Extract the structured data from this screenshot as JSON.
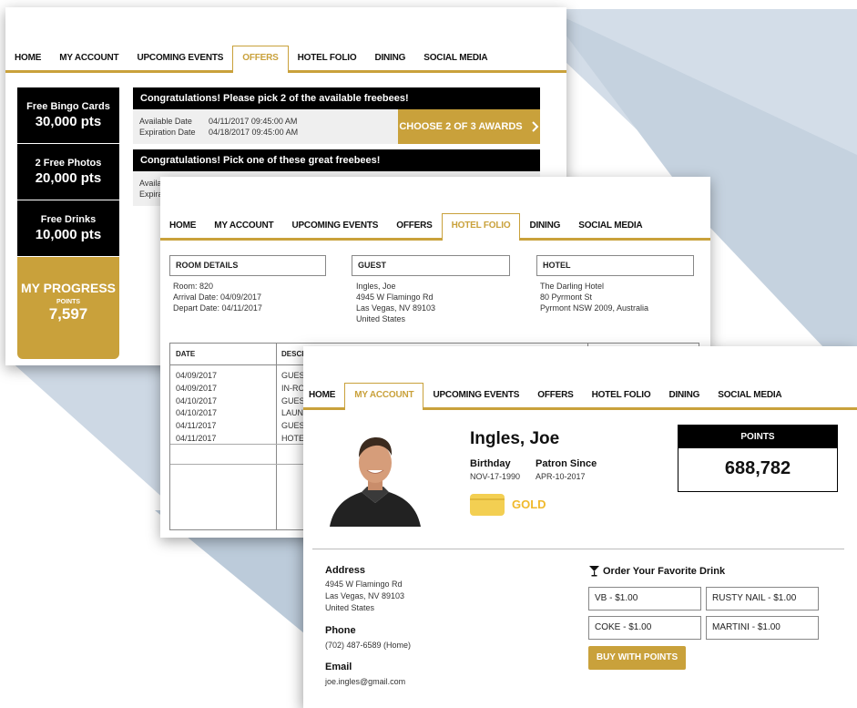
{
  "window1": {
    "nav": [
      "HOME",
      "MY ACCOUNT",
      "UPCOMING EVENTS",
      "OFFERS",
      "HOTEL FOLIO",
      "DINING",
      "SOCIAL MEDIA"
    ],
    "active_tab": "OFFERS",
    "sidebar": [
      {
        "title": "Free Bingo Cards",
        "points": "30,000 pts"
      },
      {
        "title": "2 Free Photos",
        "points": "20,000 pts"
      },
      {
        "title": "Free Drinks",
        "points": "10,000 pts"
      }
    ],
    "progress": {
      "title": "MY PROGRESS",
      "sub": "POINTS",
      "value": "7,597"
    },
    "offers": [
      {
        "header": "Congratulations! Please pick 2 of the available freebees!",
        "available_label": "Available Date",
        "available_value": "04/11/2017 09:45:00 AM",
        "expiration_label": "Expiration Date",
        "expiration_value": "04/18/2017 09:45:00 AM",
        "button": "CHOOSE 2 OF 3 AWARDS"
      },
      {
        "header": "Congratulations! Pick one of these great freebees!",
        "available_label": "Availa",
        "expiration_label": "Expira"
      }
    ]
  },
  "window2": {
    "nav": [
      "HOME",
      "MY ACCOUNT",
      "UPCOMING EVENTS",
      "OFFERS",
      "HOTEL FOLIO",
      "DINING",
      "SOCIAL MEDIA"
    ],
    "active_tab": "HOTEL FOLIO",
    "room": {
      "header": "ROOM DETAILS",
      "lines": [
        "Room: 820",
        "Arrival Date: 04/09/2017",
        "Depart Date: 04/11/2017"
      ]
    },
    "guest": {
      "header": "GUEST",
      "lines": [
        "Ingles, Joe",
        "4945 W Flamingo Rd",
        "Las Vegas, NV 89103",
        "United States"
      ]
    },
    "hotel": {
      "header": "HOTEL",
      "lines": [
        "The Darling Hotel",
        "80 Pyrmont St",
        "Pyrmont NSW 2009, Australia"
      ]
    },
    "table": {
      "headers": [
        "DATE",
        "DESCRI"
      ],
      "dates": [
        "04/09/2017",
        "04/09/2017",
        "04/10/2017",
        "04/10/2017",
        "04/11/2017",
        "04/11/2017"
      ],
      "descriptions": [
        "GUES",
        "IN-RO",
        "GUES",
        "LAUN",
        "GUES",
        "HOTE"
      ]
    }
  },
  "window3": {
    "nav": [
      "HOME",
      "MY ACCOUNT",
      "UPCOMING EVENTS",
      "OFFERS",
      "HOTEL FOLIO",
      "DINING",
      "SOCIAL MEDIA"
    ],
    "active_tab": "MY ACCOUNT",
    "name": "Ingles, Joe",
    "birthday_label": "Birthday",
    "birthday": "NOV-17-1990",
    "patron_label": "Patron Since",
    "patron_since": "APR-10-2017",
    "tier": "GOLD",
    "points_label": "POINTS",
    "points": "688,782",
    "address_label": "Address",
    "address": [
      "4945 W Flamingo Rd",
      "Las Vegas, NV 89103",
      "United States"
    ],
    "phone_label": "Phone",
    "phone": "(702) 487-6589 (Home)",
    "email_label": "Email",
    "email": "joe.ingles@gmail.com",
    "drink_header": "Order Your Favorite Drink",
    "drinks": [
      "VB - $1.00",
      "RUSTY NAIL - $1.00",
      "COKE - $1.00",
      "MARTINI - $1.00"
    ],
    "buy_button": "BUY WITH POINTS"
  },
  "colors": {
    "accent": "#c9a13b",
    "tier_gold": "#f0b92c",
    "background_shape": "#c9d6e3"
  }
}
